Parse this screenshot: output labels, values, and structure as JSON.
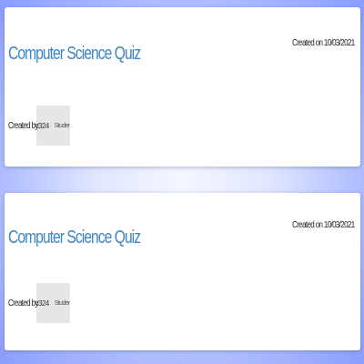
{
  "quizzes": [
    {
      "title": "Computer Science Quiz",
      "created_on": "Created on 10/03/2021",
      "created_by_label": "Created by",
      "creator": {
        "username": "lc324",
        "role": "Student"
      }
    },
    {
      "title": "Computer Science Quiz",
      "created_on": "Created on 10/03/2021",
      "created_by_label": "Created by",
      "creator": {
        "username": "lc324",
        "role": "Student"
      }
    }
  ],
  "colors": {
    "title": "#3d84c8",
    "card_background": "#ffffff",
    "chip_background": "#e6e6e6",
    "page_background": "#aebcff"
  }
}
